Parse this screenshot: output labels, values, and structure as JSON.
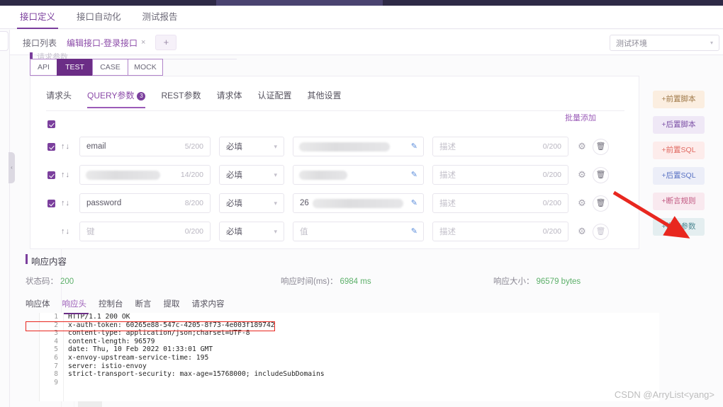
{
  "main_nav": {
    "items": [
      {
        "label": "接口定义",
        "active": true
      },
      {
        "label": "接口自动化",
        "active": false
      },
      {
        "label": "测试报告",
        "active": false
      }
    ]
  },
  "doc_tabs": {
    "items": [
      {
        "label": "接口列表",
        "active": false,
        "closable": false
      },
      {
        "label": "编辑接口-登录接口",
        "active": true,
        "closable": true
      }
    ],
    "close_glyph": "×",
    "add_label": "+",
    "environment": {
      "value": "测试环境",
      "caret": "▾"
    }
  },
  "ghost_heading": "请求参数",
  "api_tabs": {
    "items": [
      {
        "label": "API",
        "active": false
      },
      {
        "label": "TEST",
        "active": true
      },
      {
        "label": "CASE",
        "active": false
      },
      {
        "label": "MOCK",
        "active": false
      }
    ]
  },
  "sub_tabs": {
    "items": [
      {
        "label": "请求头",
        "active": false,
        "badge": ""
      },
      {
        "label": "QUERY参数",
        "active": true,
        "badge": "3"
      },
      {
        "label": "REST参数",
        "active": false,
        "badge": ""
      },
      {
        "label": "请求体",
        "active": false,
        "badge": ""
      },
      {
        "label": "认证配置",
        "active": false,
        "badge": ""
      },
      {
        "label": "其他设置",
        "active": false,
        "badge": ""
      }
    ]
  },
  "params_table": {
    "batch_add_label": "批量添加",
    "select_all_checked": true,
    "move_up_glyph": "↑",
    "move_down_glyph": "↓",
    "pencil_glyph": "✎",
    "gear_glyph": "⚙",
    "trash_glyph": "🗑",
    "rows": [
      {
        "checked": true,
        "key": "email",
        "key_count": "5/200",
        "required": "必填",
        "value": "",
        "value_redacted": true,
        "value_prefix": "",
        "desc_placeholder": "描述",
        "desc_count": "0/200",
        "trash_enabled": true
      },
      {
        "checked": true,
        "key": "",
        "key_redacted": true,
        "key_count": "14/200",
        "required": "必填",
        "value": "",
        "value_redacted": true,
        "value_prefix": "",
        "desc_placeholder": "描述",
        "desc_count": "0/200",
        "trash_enabled": true
      },
      {
        "checked": true,
        "key": "password",
        "key_count": "8/200",
        "required": "必填",
        "value": "",
        "value_redacted": true,
        "value_prefix": "26",
        "desc_placeholder": "描述",
        "desc_count": "0/200",
        "trash_enabled": true
      },
      {
        "checked": false,
        "key": "",
        "key_placeholder": "键",
        "key_count": "0/200",
        "required": "必填",
        "value": "",
        "value_placeholder": "值",
        "desc_placeholder": "描述",
        "desc_count": "0/200",
        "trash_enabled": false
      }
    ]
  },
  "action_buttons": [
    {
      "label": "+前置脚本",
      "bg": "#fbeee0",
      "fg": "#a07a4a"
    },
    {
      "label": "+后置脚本",
      "bg": "#efe8f6",
      "fg": "#7b4fa5"
    },
    {
      "label": "+前置SQL",
      "bg": "#fdeceb",
      "fg": "#e06a62"
    },
    {
      "label": "+后置SQL",
      "bg": "#eceef8",
      "fg": "#5a73c4"
    },
    {
      "label": "+断言规则",
      "bg": "#f9e9ef",
      "fg": "#c0557f"
    },
    {
      "label": "+提取参数",
      "bg": "#e4eef0",
      "fg": "#4f8a94"
    }
  ],
  "response": {
    "title": "响应内容",
    "status_label": "状态码：",
    "status_value": "200",
    "time_label": "响应时间(ms)：",
    "time_value": "6984 ms",
    "size_label": "响应大小：",
    "size_value": "96579 bytes",
    "tabs": [
      {
        "label": "响应体",
        "active": false
      },
      {
        "label": "响应头",
        "active": true
      },
      {
        "label": "控制台",
        "active": false
      },
      {
        "label": "断言",
        "active": false
      },
      {
        "label": "提取",
        "active": false
      },
      {
        "label": "请求内容",
        "active": false
      }
    ],
    "code_lines": [
      {
        "no": "1",
        "text": "HTTP/1.1 200 OK"
      },
      {
        "no": "2",
        "text": "x-auth-token: 60265e88-547c-4205-8f73-4e003f189742"
      },
      {
        "no": "3",
        "text": "content-type: application/json;charset=UTF-8"
      },
      {
        "no": "4",
        "text": "content-length: 96579"
      },
      {
        "no": "5",
        "text": "date: Thu, 10 Feb 2022 01:33:01 GMT"
      },
      {
        "no": "6",
        "text": "x-envoy-upstream-service-time: 195"
      },
      {
        "no": "7",
        "text": "server: istio-envoy"
      },
      {
        "no": "8",
        "text": "strict-transport-security: max-age=15768000; includeSubDomains"
      },
      {
        "no": "9",
        "text": ""
      }
    ]
  },
  "left_rail": {
    "collapse_glyph": "‹"
  },
  "watermark": "CSDN @ArryList<yang>",
  "colors": {
    "brand_purple": "#7b3f9d",
    "dark_band": "#2e2a46",
    "status_green": "#5db06a",
    "annotation_red": "#e8271f"
  }
}
